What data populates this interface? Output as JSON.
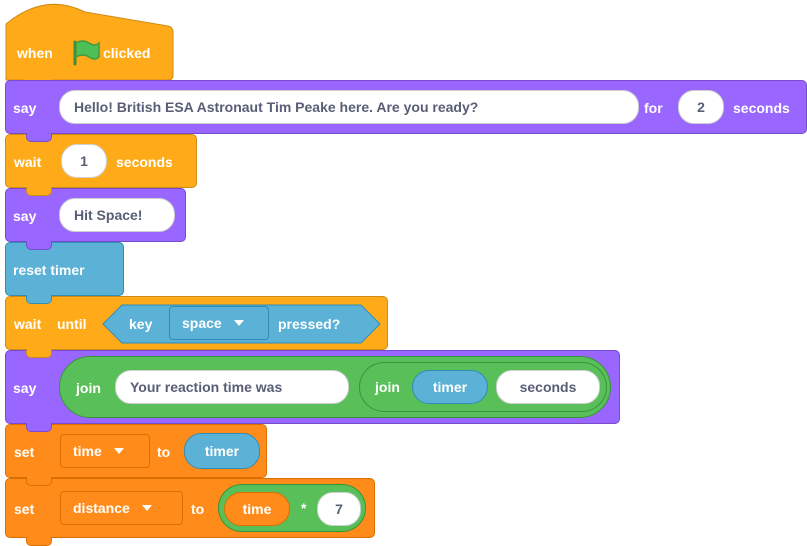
{
  "blocks": {
    "when_flag": {
      "when": "when",
      "clicked": "clicked",
      "flag_icon": "green-flag-icon"
    },
    "say_intro": {
      "say": "say",
      "message": "Hello! British ESA Astronaut Tim Peake here. Are you ready?",
      "for": "for",
      "duration": "2",
      "seconds": "seconds"
    },
    "wait_1": {
      "wait": "wait",
      "value": "1",
      "seconds": "seconds"
    },
    "say_hit": {
      "say": "say",
      "message": "Hit Space!"
    },
    "reset_timer": {
      "label": "reset timer"
    },
    "wait_until": {
      "wait": "wait",
      "until": "until",
      "key": "key",
      "key_value": "space",
      "pressed": "pressed?"
    },
    "say_join": {
      "say": "say",
      "join_outer": "join",
      "text": "Your reaction time was",
      "join_inner": "join",
      "timer": "timer",
      "seconds": "seconds"
    },
    "set_time": {
      "set": "set",
      "variable": "time",
      "to": "to",
      "value": "timer"
    },
    "set_distance": {
      "set": "set",
      "variable": "distance",
      "to": "to",
      "left": "time",
      "operator": "*",
      "right": "7"
    }
  },
  "colors": {
    "events": "#ffab19",
    "looks": "#9966ff",
    "sensing": "#5cb1d6",
    "variables": "#ff8c1a",
    "operators": "#59c059",
    "control": "#ffab19"
  }
}
